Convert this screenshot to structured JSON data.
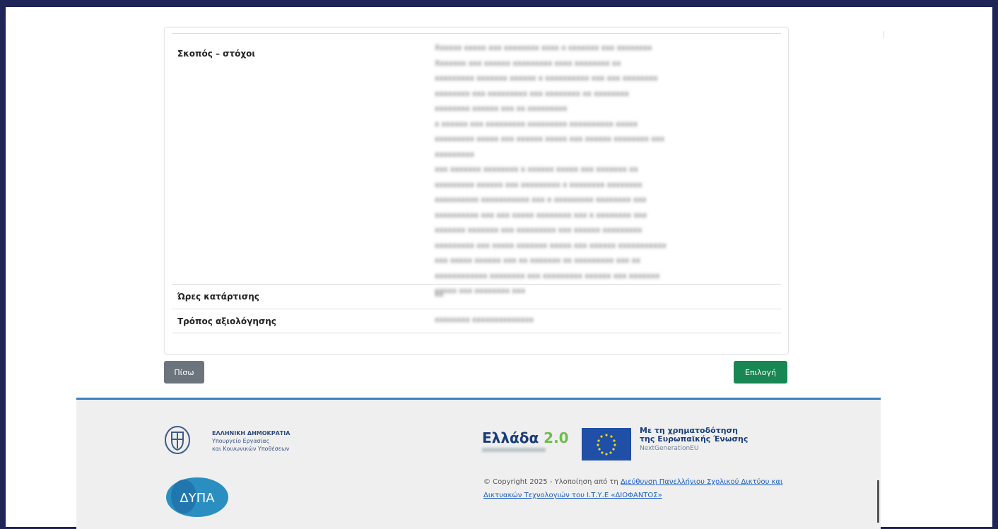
{
  "details": {
    "goals_label": "Σκοπός – στόχοι",
    "goals_value_lines": [
      "Xxxxxx xxxxx xxx xxxxxxxx xxxx x xxxxxxx xxx xxxxxxxx",
      "Xxxxxxx xxx xxxxxx xxxxxxxxx xxxx xxxxxxxx xx",
      "xxxxxxxxx xxxxxxx xxxxxx x xxxxxxxxxx xxx xxx xxxxxxxx",
      "xxxxxxxx xxx xxxxxxxxx xxx xxxxxxxx xx xxxxxxxx",
      "xxxxxxxx xxxxxx xxx xx xxxxxxxxx",
      "x xxxxxx xxx xxxxxxxxx xxxxxxxxx xxxxxxxxxx xxxxx",
      "xxxxxxxxx xxxxx xxx xxxxxx xxxxx xxx xxxxxx xxxxxxxx xxx",
      "xxxxxxxxx",
      "xxx xxxxxxx xxxxxxxx x xxxxxx xxxxx xxx xxxxxxx xx",
      "xxxxxxxxx xxxxxx xxx xxxxxxxxx x xxxxxxxx xxxxxxxx",
      "xxxxxxxxxx xxxxxxxxxxx xxx x xxxxxxxxx xxxxxxxx xxx",
      "xxxxxxxxxx xxx xxx xxxxx xxxxxxxx xxx x xxxxxxxx xxx",
      "xxxxxxx xxxxxxx xxx xxxxxxxxx xxx xxxxxx xxxxxxxxx",
      "xxxxxxxxx xxx xxxxx xxxxxxx xxxxx xxx xxxxxx xxxxxxxxxxx",
      "xxx xxxxx xxxxxx xxx xx xxxxxxx xx xxxxxxxxx xxx xx",
      "xxxxxxxxxxxx xxxxxxxx xxx xxxxxxxxx xxxxxx xxx xxxxxxx",
      "xxxxx xxx xxxxxxxx xxx"
    ],
    "hours_label": "Ώρες κατάρτισης",
    "hours_value": "xx",
    "evaluation_label": "Τρόπος αξιολόγησης",
    "evaluation_value": "xxxxxxxx xxxxxxxxxxxxxx"
  },
  "buttons": {
    "back": "Πίσω",
    "select": "Επιλογή"
  },
  "footer": {
    "gov_line1": "ΕΛΛΗΝΙΚΗ ΔΗΜΟΚΡΑΤΙΑ",
    "gov_line2": "Υπουργείο Εργασίας",
    "gov_line3": "και Κοινωνικών Υποθέσεων",
    "dypa_logo": "ΔΥΠΑ",
    "ellada_brand": "Ελλάδα",
    "ellada_version": "2.0",
    "eu_line1": "Με τη χρηματοδότηση",
    "eu_line2": "της Ευρωπαϊκής Ένωσης",
    "eu_line3": "NextGenerationEU",
    "copyright_prefix": "© Copyright 2025 - Υλοποίηση από τη ",
    "copyright_link": "Διεύθυνση Πανελλήνιου Σχολικού Δικτύου και Δικτυακών Τεχνολογιών του Ι.Τ.Υ.Ε «ΔΙΟΦΑΝΤΟΣ»"
  },
  "colors": {
    "background": "#1f2557",
    "back_button": "#6c757d",
    "select_button": "#198754",
    "footer_accent": "#3a7fc0",
    "link": "#1b5fbf"
  }
}
